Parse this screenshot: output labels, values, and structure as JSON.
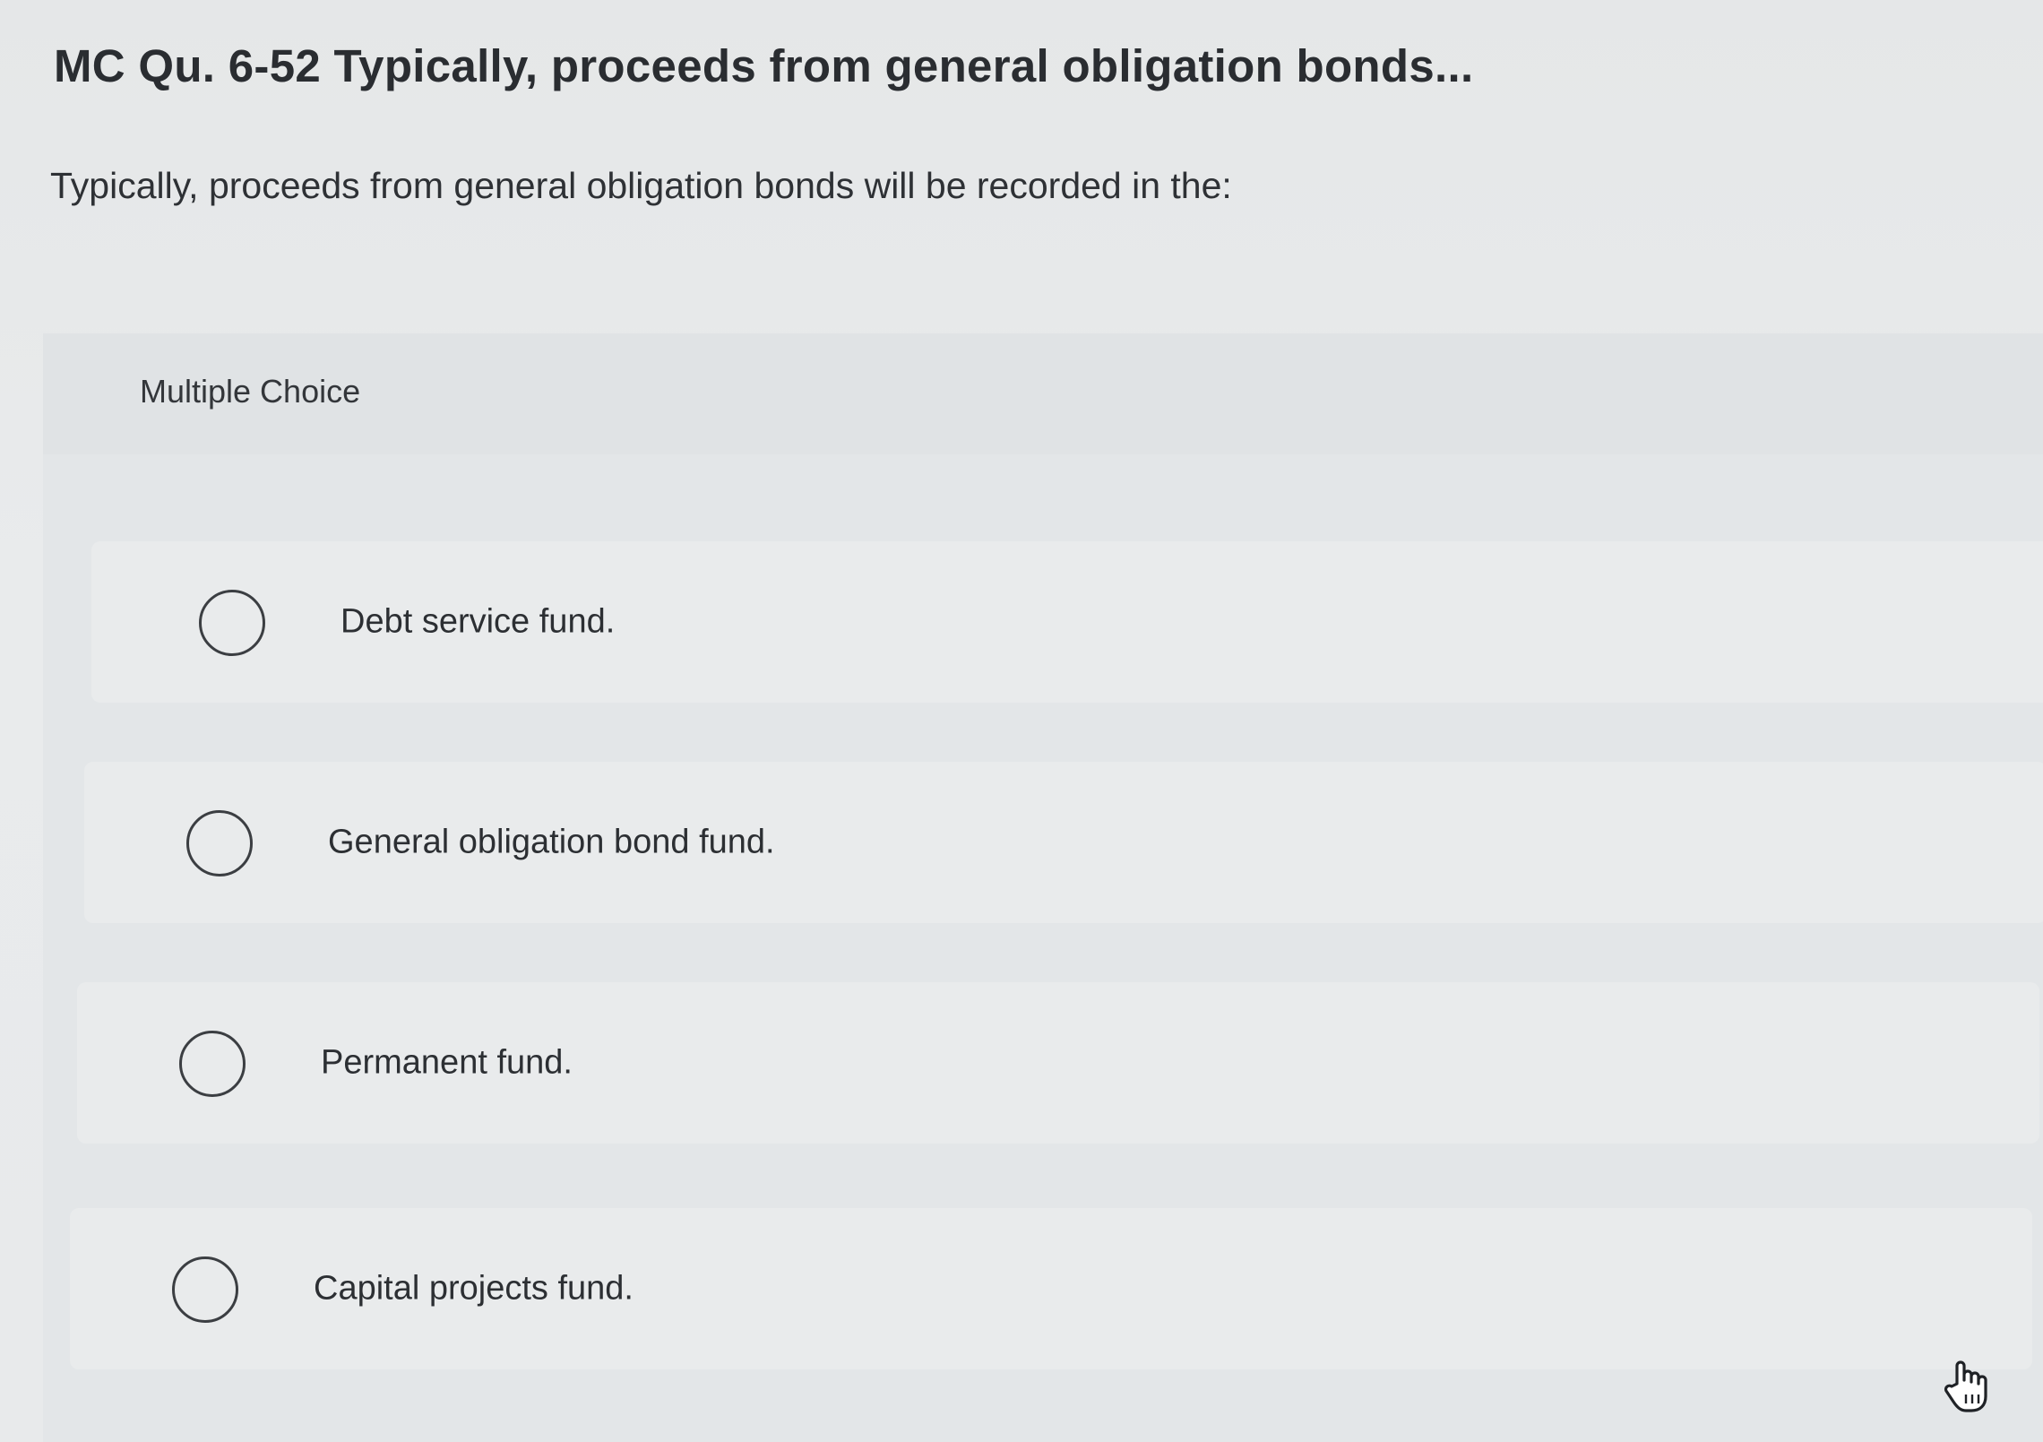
{
  "question": {
    "title": "MC Qu. 6-52 Typically, proceeds from general obligation bonds...",
    "text": "Typically, proceeds from general obligation bonds will be recorded in the:"
  },
  "multiple_choice": {
    "label": "Multiple Choice",
    "options": [
      {
        "label": "Debt service fund.",
        "selected": false
      },
      {
        "label": "General obligation bond fund.",
        "selected": false
      },
      {
        "label": "Permanent fund.",
        "selected": false
      },
      {
        "label": "Capital projects fund.",
        "selected": false
      }
    ]
  },
  "cursor": {
    "icon": "hand-pointer-icon"
  }
}
